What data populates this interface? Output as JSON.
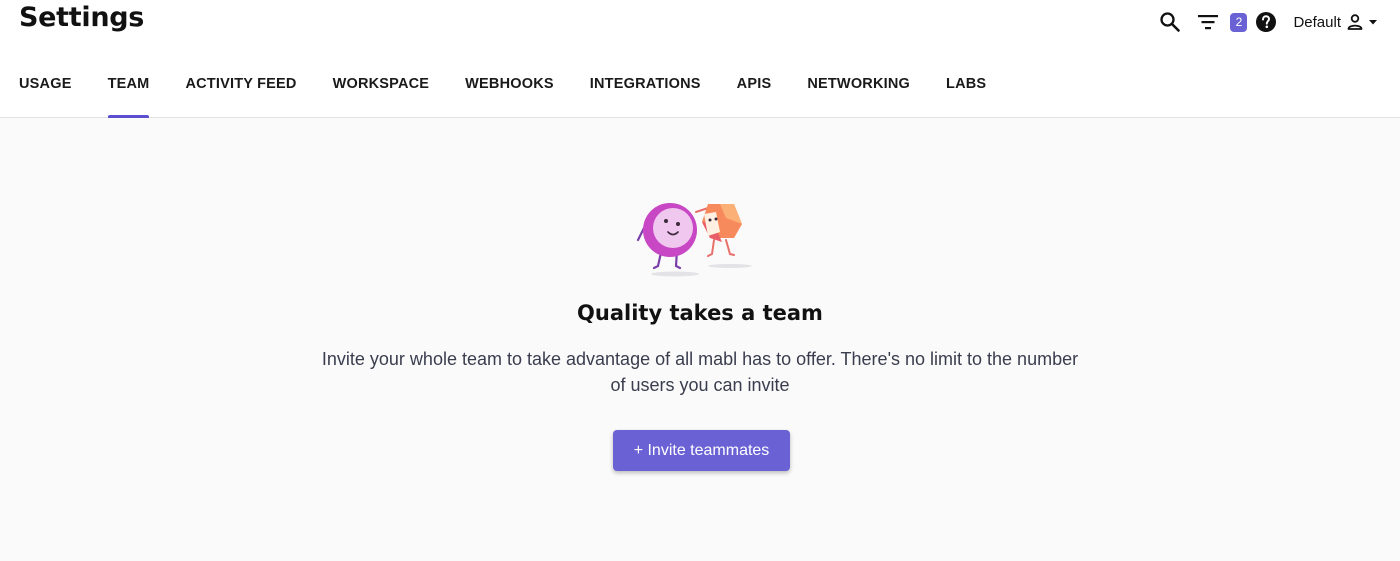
{
  "header": {
    "title": "Settings",
    "filter_count": "2",
    "workspace_label": "Default"
  },
  "tabs": [
    {
      "label": "USAGE",
      "active": false
    },
    {
      "label": "TEAM",
      "active": true
    },
    {
      "label": "ACTIVITY FEED",
      "active": false
    },
    {
      "label": "WORKSPACE",
      "active": false
    },
    {
      "label": "WEBHOOKS",
      "active": false
    },
    {
      "label": "INTEGRATIONS",
      "active": false
    },
    {
      "label": "APIS",
      "active": false
    },
    {
      "label": "NETWORKING",
      "active": false
    },
    {
      "label": "LABS",
      "active": false
    }
  ],
  "empty_state": {
    "heading": "Quality takes a team",
    "description": "Invite your whole team to take advantage of all mabl has to offer. There's no limit to the number of users you can invite",
    "button_label": "+ Invite teammates"
  },
  "colors": {
    "accent": "#6a62d4",
    "tab_indicator": "#5b4fcf",
    "background": "#fafafa"
  },
  "icons": [
    "search-icon",
    "filter-icon",
    "help-icon",
    "user-icon",
    "caret-down-icon"
  ]
}
